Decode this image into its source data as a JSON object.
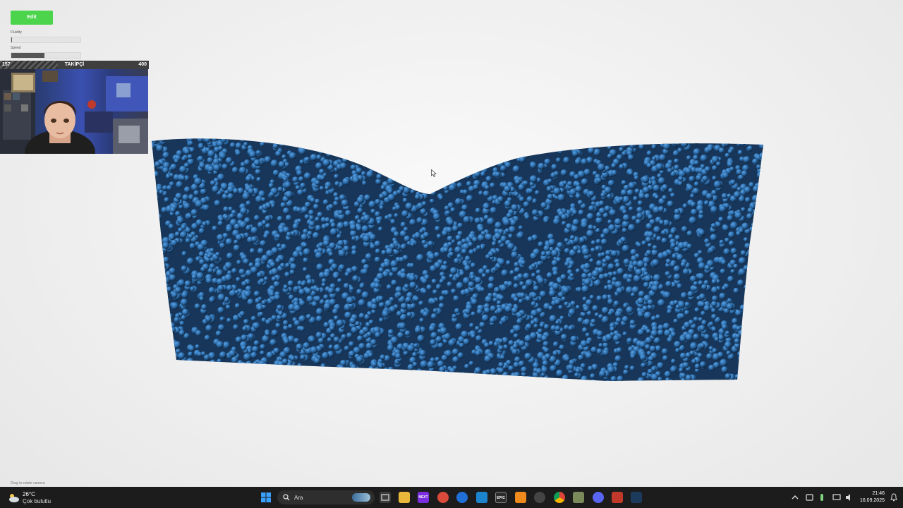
{
  "controls": {
    "edit_label": "Edit",
    "fluidity_label": "Fluidity",
    "fluidity_level_pct": 1,
    "speed_label": "Speed",
    "speed_level_pct": 48
  },
  "follower_goal": {
    "current": "157",
    "title": "TAKİPÇİ",
    "goal": "400",
    "progress_pct": 39
  },
  "simulation": {
    "particle_color": "#2e6fb0",
    "background_color": "#f1f1f1"
  },
  "hint": {
    "text": "Drag to rotate camera"
  },
  "taskbar": {
    "weather": {
      "temp": "26°C",
      "condition": "Çok bulutlu"
    },
    "search_placeholder": "Ara",
    "pinned_icons": [
      "file-explorer-icon",
      "nexus-app-icon",
      "red-app-icon",
      "firefox-icon",
      "vscode-icon",
      "epic-games-icon",
      "vlc-icon",
      "steam-like-icon",
      "chrome-icon",
      "notepad-icon",
      "discord-icon",
      "voice-meter-icon",
      "steam-icon"
    ],
    "clock": {
      "time": "21:46",
      "date": "16.09.2025"
    }
  }
}
